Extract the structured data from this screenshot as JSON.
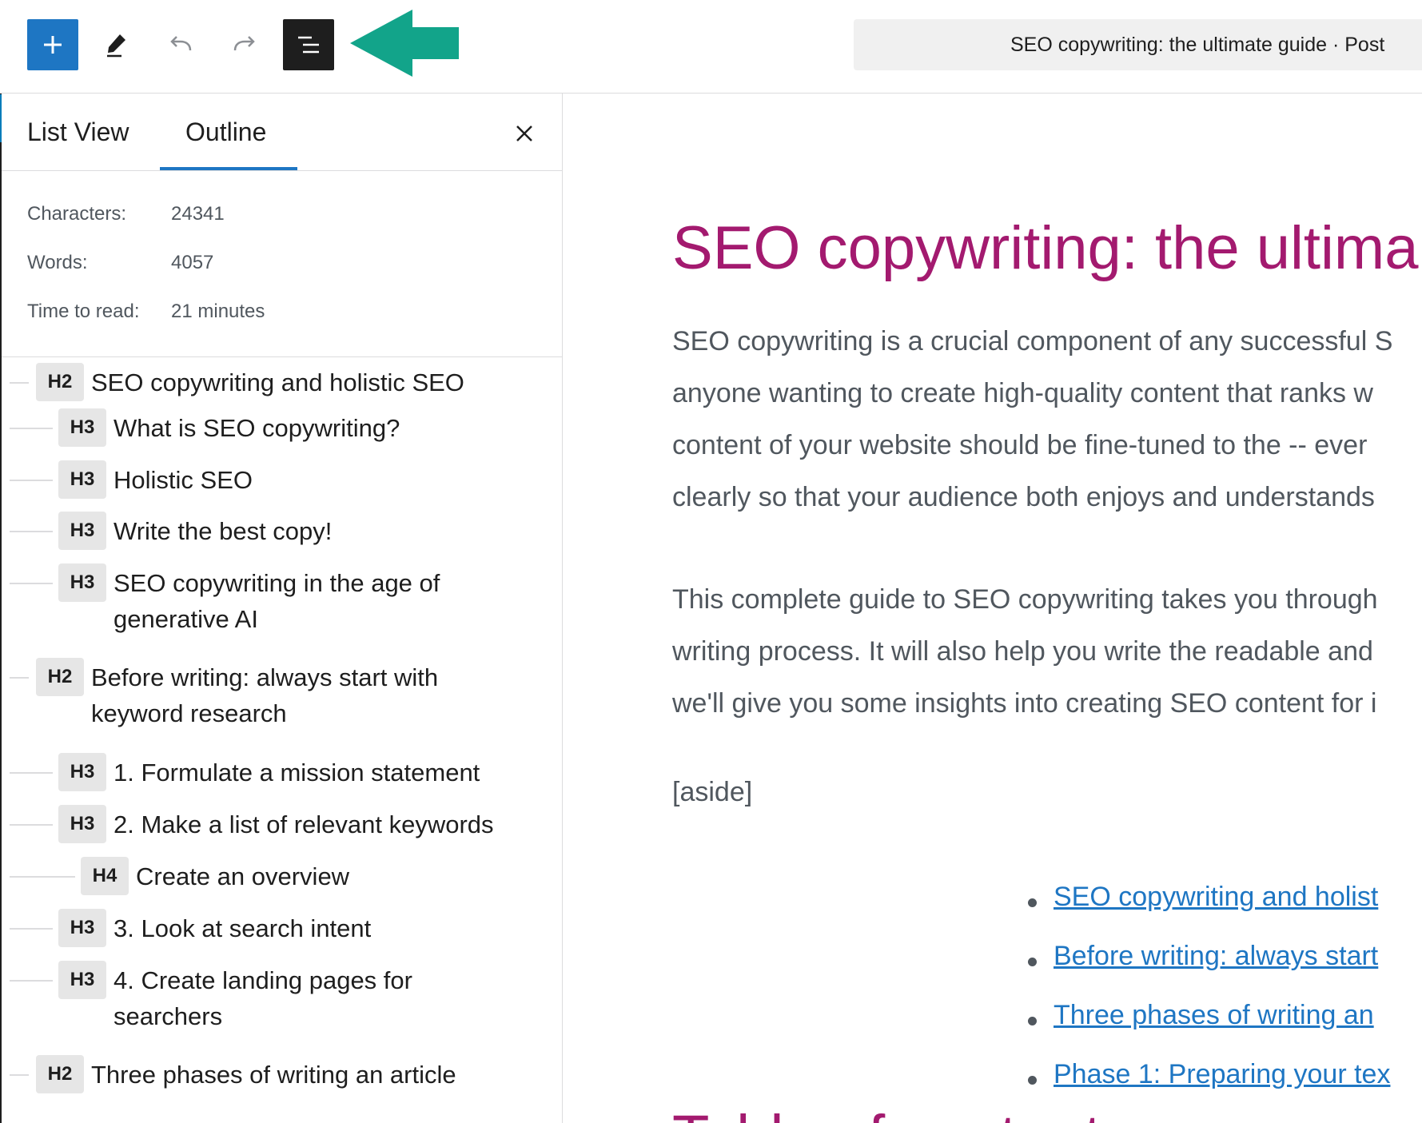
{
  "toolbar": {
    "add_icon": "plus-icon",
    "edit_icon": "pencil-icon",
    "undo_icon": "undo-icon",
    "redo_icon": "redo-icon",
    "outline_icon": "document-overview-icon",
    "annotation_arrow_color": "#12a48a",
    "document_title": "SEO copywriting: the ultimate guide · Post"
  },
  "sidebar": {
    "tabs": [
      {
        "label": "List View",
        "selected": false
      },
      {
        "label": "Outline",
        "selected": true
      }
    ],
    "close_icon": "close-icon",
    "stats": [
      {
        "label": "Characters:",
        "value": "24341"
      },
      {
        "label": "Words:",
        "value": "4057"
      },
      {
        "label": "Time to read:",
        "value": "21 minutes"
      }
    ],
    "outline": [
      {
        "level": "H2",
        "text": "SEO copywriting and holistic SEO"
      },
      {
        "level": "H3",
        "text": "What is SEO copywriting?"
      },
      {
        "level": "H3",
        "text": "Holistic SEO"
      },
      {
        "level": "H3",
        "text": "Write the best copy!"
      },
      {
        "level": "H3",
        "text": "SEO copywriting in the age of generative AI"
      },
      {
        "level": "H2",
        "text": "Before writing: always start with keyword research"
      },
      {
        "level": "H3",
        "text": "1. Formulate a mission statement"
      },
      {
        "level": "H3",
        "text": "2. Make a list of relevant keywords"
      },
      {
        "level": "H4",
        "text": "Create an overview"
      },
      {
        "level": "H3",
        "text": "3. Look at search intent"
      },
      {
        "level": "H3",
        "text": "4. Create landing pages for searchers"
      },
      {
        "level": "H2",
        "text": "Three phases of writing an article"
      }
    ]
  },
  "content": {
    "title": "SEO copywriting: the ultima",
    "paragraph1": [
      "SEO copywriting is a crucial component of any successful S",
      "anyone wanting to create high-quality content that ranks w",
      "content of your website should be fine-tuned to the -- ever",
      "clearly so that your audience both enjoys and understands"
    ],
    "paragraph2": [
      "This complete guide to SEO copywriting takes you through",
      "writing process. It will also help you write the readable and",
      "we'll give you some insights into creating SEO content for i"
    ],
    "aside": "[aside]",
    "toc_links": [
      "SEO copywriting and holist",
      "Before writing: always start",
      "Three phases of writing an",
      "Phase 1: Preparing your tex"
    ],
    "toc_heading_partial": "Table of contents"
  },
  "colors": {
    "accent": "#1e76c3",
    "title": "#a31a6f",
    "body_text": "#50575e"
  }
}
